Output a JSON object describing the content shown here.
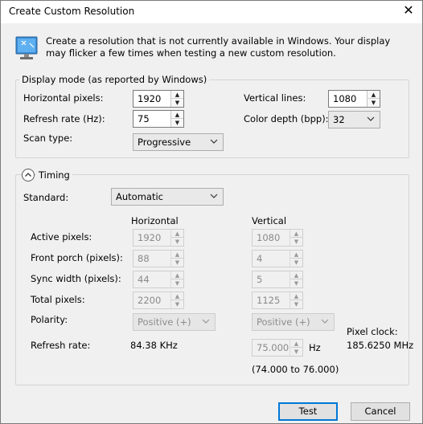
{
  "window": {
    "title": "Create Custom Resolution",
    "close_glyph": "✕"
  },
  "description": "Create a resolution that is not currently available in Windows. Your display may flicker a few times when testing a new custom resolution.",
  "display_mode": {
    "legend": "Display mode (as reported by Windows)",
    "horizontal_pixels": {
      "label": "Horizontal pixels:",
      "value": "1920"
    },
    "refresh_rate": {
      "label": "Refresh rate (Hz):",
      "value": "75"
    },
    "scan_type": {
      "label": "Scan type:",
      "value": "Progressive"
    },
    "vertical_lines": {
      "label": "Vertical lines:",
      "value": "1080"
    },
    "color_depth": {
      "label": "Color depth (bpp):",
      "value": "32"
    }
  },
  "timing": {
    "legend": "Timing",
    "standard": {
      "label": "Standard:",
      "value": "Automatic"
    },
    "col_horizontal": "Horizontal",
    "col_vertical": "Vertical",
    "rows": [
      {
        "label": "Active pixels:",
        "h": "1920",
        "v": "1080"
      },
      {
        "label": "Front porch (pixels):",
        "h": "88",
        "v": "4"
      },
      {
        "label": "Sync width (pixels):",
        "h": "44",
        "v": "5"
      },
      {
        "label": "Total pixels:",
        "h": "2200",
        "v": "1125"
      }
    ],
    "polarity": {
      "label": "Polarity:",
      "h": "Positive (+)",
      "v": "Positive (+)"
    },
    "refresh_rate": {
      "label": "Refresh rate:",
      "h": "84.38 KHz",
      "v": "75.000",
      "unit": "Hz",
      "range": "(74.000 to 76.000)"
    },
    "pixel_clock": {
      "label": "Pixel clock:",
      "value": "185.6250 MHz"
    }
  },
  "buttons": {
    "test": "Test",
    "cancel": "Cancel"
  },
  "colors": {
    "accent": "#0078d7",
    "background": "#f0f0f0"
  }
}
